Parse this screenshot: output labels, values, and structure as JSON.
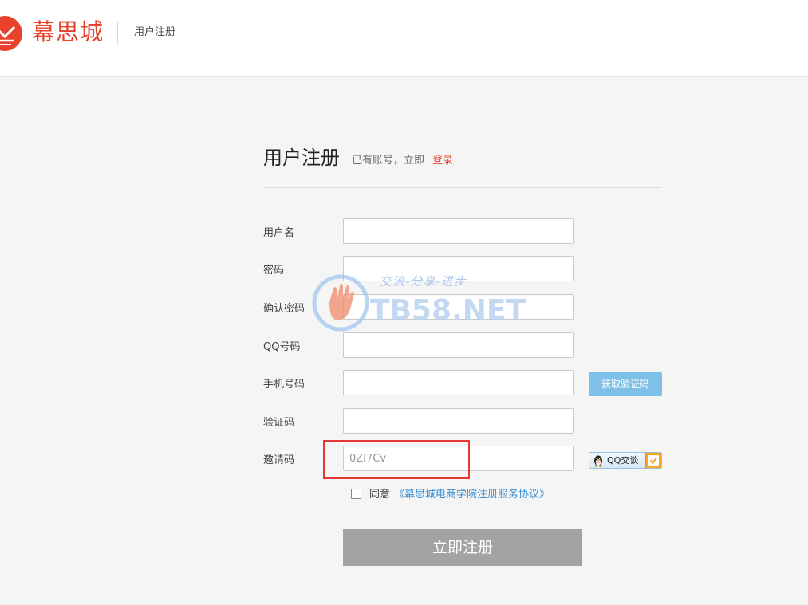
{
  "header": {
    "brand": "幕思城",
    "subtitle": "用户注册"
  },
  "form": {
    "title": "用户注册",
    "have_account": "已有账号，立即",
    "login_link": "登录",
    "fields": [
      {
        "label": "用户名",
        "value": ""
      },
      {
        "label": "密码",
        "value": ""
      },
      {
        "label": "确认密码",
        "value": ""
      },
      {
        "label": "QQ号码",
        "value": ""
      },
      {
        "label": "手机号码",
        "value": ""
      },
      {
        "label": "验证码",
        "value": ""
      },
      {
        "label": "邀请码",
        "value": "0ZI7Cv"
      }
    ],
    "get_code_button": "获取验证码",
    "qq_button": "QQ交谈",
    "agree_prefix": "同意",
    "agree_link": "《幕思城电商学院注册服务协议》",
    "agree_checked": false,
    "submit_button": "立即注册"
  },
  "watermark": {
    "text": "TB58.NET",
    "slogan": "交流-分享-进步"
  },
  "colors": {
    "brand": "#e8412c",
    "link": "#3b8fd0",
    "code_button": "#7ec0e8",
    "submit_button": "#a3a3a3",
    "highlight_box": "#e53935"
  },
  "icons": {
    "logo": "envelope-logo-icon",
    "qq": "qq-penguin-icon",
    "check": "checkmark-icon"
  }
}
